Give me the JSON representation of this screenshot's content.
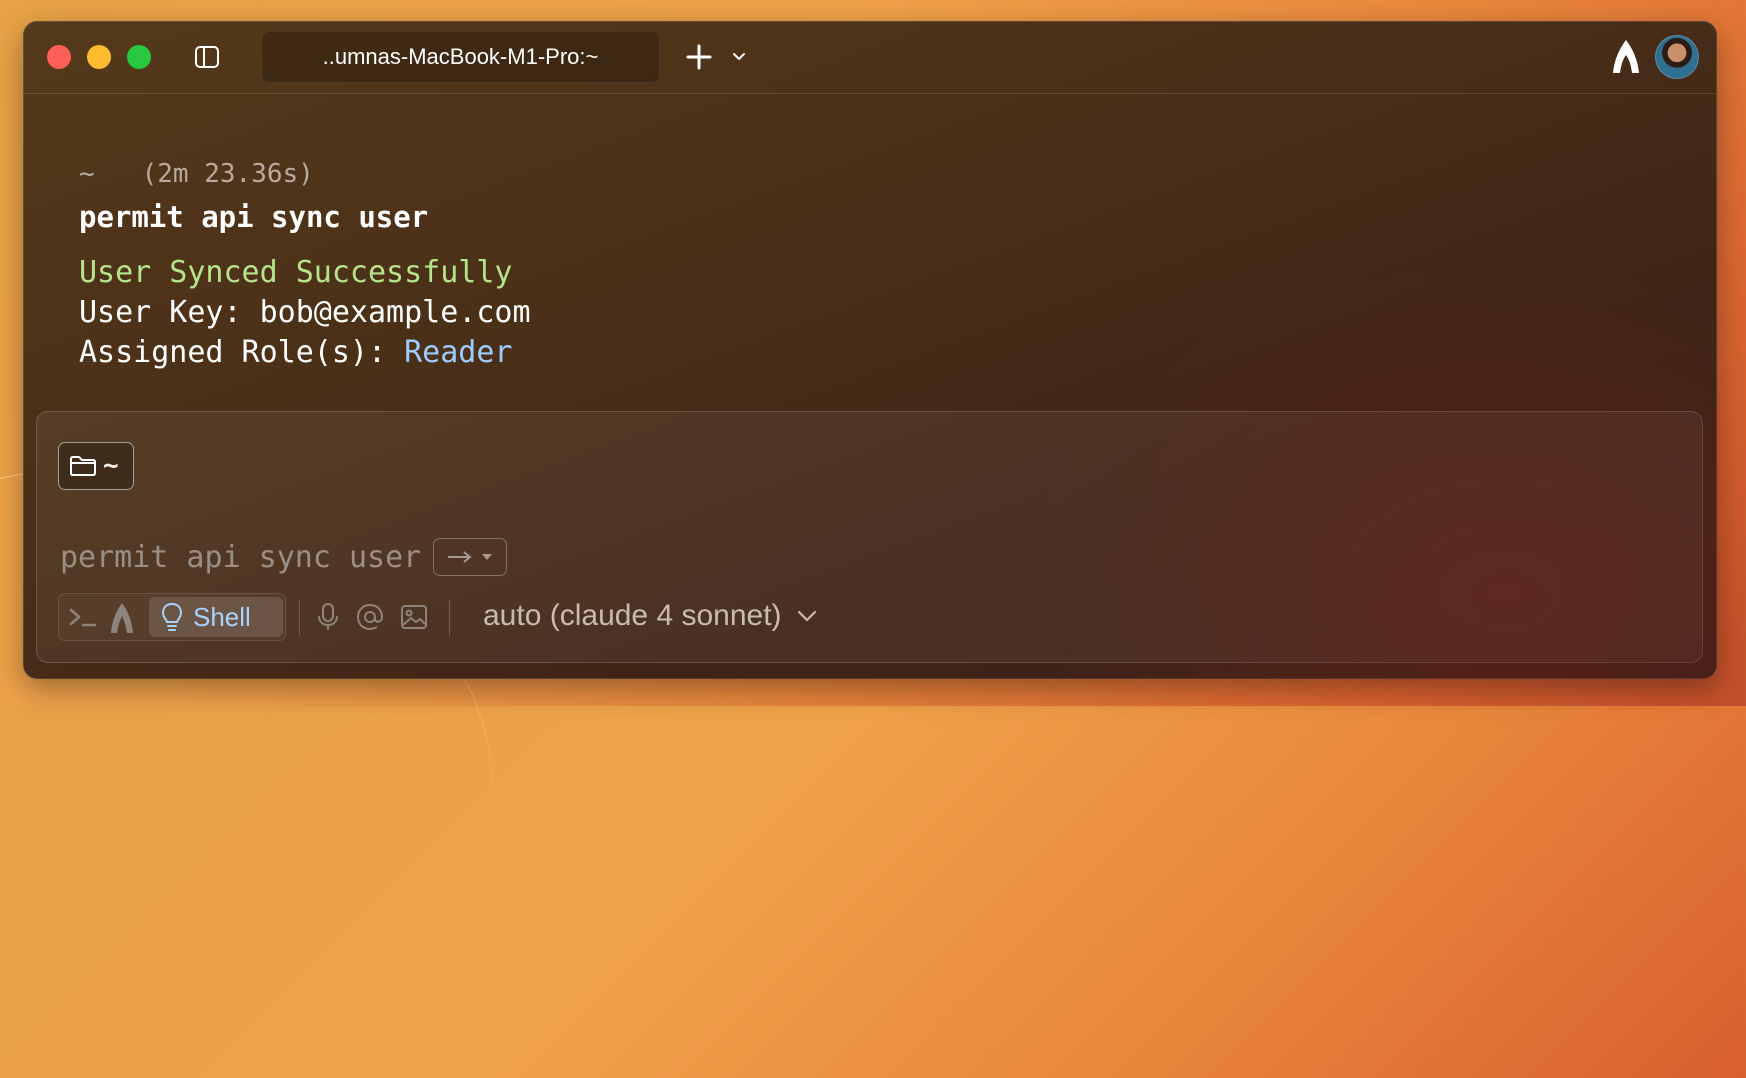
{
  "titlebar": {
    "tab_title": "..umnas-MacBook-M1-Pro:~"
  },
  "output": {
    "prompt_dir": "~",
    "duration": "(2m 23.36s)",
    "command": "permit api sync user",
    "success_text": "User Synced Successfully",
    "user_key_label": "User Key: ",
    "user_key_value": "bob@example.com",
    "roles_label": "Assigned Role(s): ",
    "roles_value": "Reader"
  },
  "input": {
    "directory": "~",
    "placeholder": "permit api sync user",
    "mode_shell_label": "Shell",
    "model_label": "auto (claude 4 sonnet)"
  },
  "colors": {
    "success_green": "#b5e48c",
    "role_blue": "#9ecbff",
    "shell_accent": "#a9d2ff",
    "traffic_close": "#fe5f57",
    "traffic_min": "#febc2e",
    "traffic_max": "#28c840"
  },
  "icons": {
    "sidebar": "sidebar-toggle-icon",
    "new_tab": "plus-icon",
    "tab_menu": "chevron-down-icon",
    "brand": "warp-logo-icon",
    "folder": "folder-icon",
    "terminal": "terminal-prompt-icon",
    "agent": "agent-icon",
    "shell": "lightbulb-icon",
    "mic": "microphone-icon",
    "mention": "at-sign-icon",
    "image": "image-icon"
  }
}
